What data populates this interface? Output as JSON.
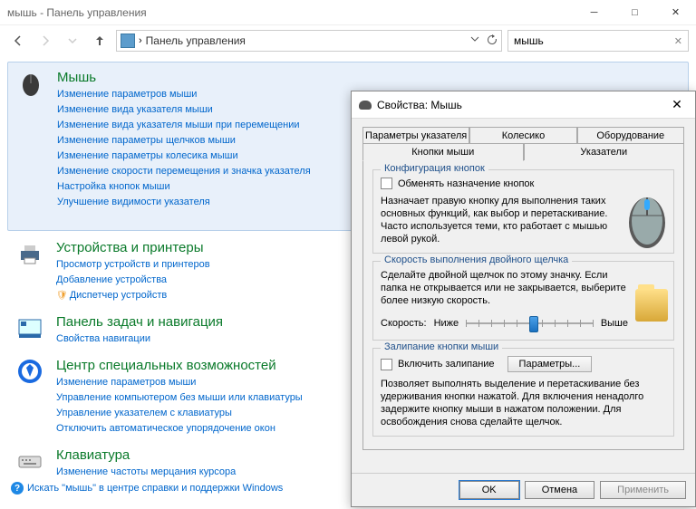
{
  "titlebar": {
    "title": "мышь - Панель управления"
  },
  "nav": {
    "breadcrumb": "Панель управления"
  },
  "search": {
    "value": "мышь"
  },
  "sections": [
    {
      "title": "Мышь",
      "links": [
        "Изменение параметров мыши",
        "Изменение вида указателя мыши",
        "Изменение вида указателя мыши при перемещении",
        "Изменение параметры щелчков мыши",
        "Изменение параметры колесика мыши",
        "Изменение скорости перемещения и значка указателя",
        "Настройка кнопок мыши",
        "Улучшение видимости указателя"
      ]
    },
    {
      "title": "Устройства и принтеры",
      "links": [
        "Просмотр устройств и принтеров",
        "Добавление устройства",
        "Диспетчер устройств"
      ]
    },
    {
      "title": "Панель задач и навигация",
      "links": [
        "Свойства навигации"
      ]
    },
    {
      "title": "Центр специальных возможностей",
      "links": [
        "Изменение параметров мыши",
        "Управление компьютером без мыши или клавиатуры",
        "Управление указателем с клавиатуры",
        "Отключить автоматическое упорядочение окон"
      ]
    },
    {
      "title": "Клавиатура",
      "links": [
        "Изменение частоты мерцания курсора"
      ]
    }
  ],
  "help": "Искать \"мышь\" в центре справки и поддержки Windows",
  "modal": {
    "title": "Свойства: Мышь",
    "tabs_row1": [
      "Параметры указателя",
      "Колесико",
      "Оборудование"
    ],
    "tabs_row2": [
      "Кнопки мыши",
      "Указатели"
    ],
    "active_tab": "Кнопки мыши",
    "group1": {
      "title": "Конфигурация кнопок",
      "check": "Обменять назначение кнопок",
      "desc": "Назначает правую кнопку для выполнения таких основных функций, как выбор и перетаскивание. Часто используется теми, кто работает с мышью левой рукой."
    },
    "group2": {
      "title": "Скорость выполнения двойного щелчка",
      "desc": "Сделайте двойной щелчок по этому значку. Если папка не открывается или не закрывается, выберите более низкую скорость.",
      "speed_label": "Скорость:",
      "low": "Ниже",
      "high": "Выше"
    },
    "group3": {
      "title": "Залипание кнопки мыши",
      "check": "Включить залипание",
      "params": "Параметры...",
      "desc": "Позволяет выполнять выделение и перетаскивание без удерживания кнопки нажатой. Для включения ненадолго задержите кнопку мыши в нажатом положении. Для освобождения снова сделайте щелчок."
    },
    "buttons": {
      "ok": "OK",
      "cancel": "Отмена",
      "apply": "Применить"
    }
  }
}
